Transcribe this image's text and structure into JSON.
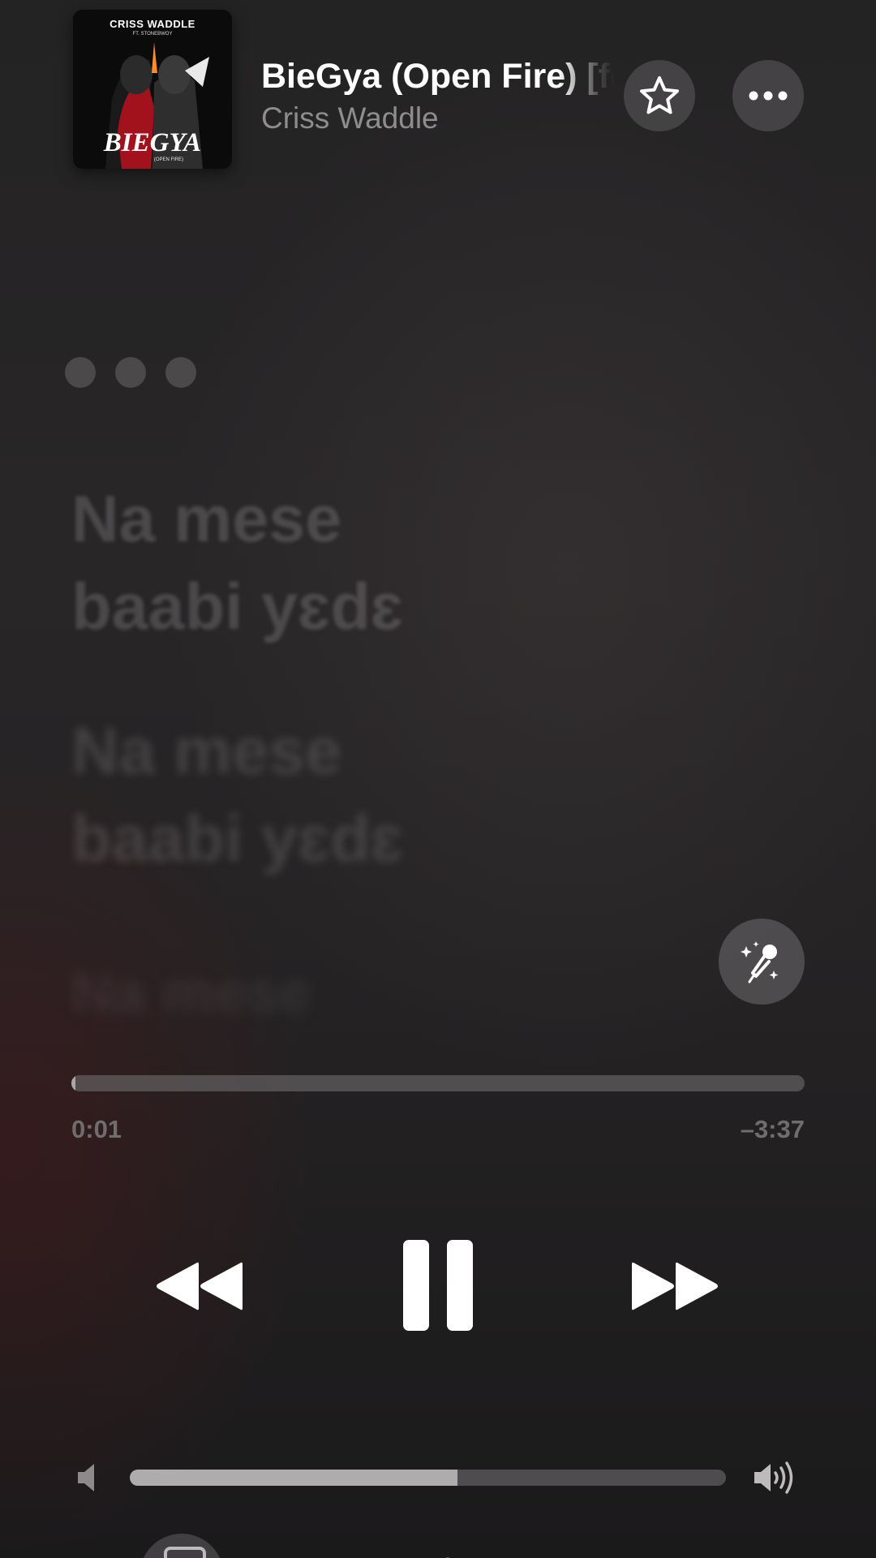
{
  "now_playing": {
    "artwork": {
      "top_text": "CRISS WADDLE",
      "sub_text": "FT. STONEBWOY",
      "main_text": "BIEGYA",
      "small_text": "(OPEN FIRE)"
    },
    "title": "BieGya (Open Fire) [feat. Stonebwoy]",
    "artist": "Criss Waddle"
  },
  "header_actions": {
    "favorite_icon": "star-icon",
    "more_icon": "ellipsis-icon"
  },
  "lyrics": {
    "lines": [
      "Na mese\nbaabi yɛdɛ",
      "Na mese\nbaabi yɛdɛ",
      "Na mese"
    ],
    "singalong_icon": "microphone-sparkle-icon"
  },
  "playback": {
    "elapsed": "0:01",
    "remaining": "–3:37",
    "progress": 0.005
  },
  "transport": {
    "rewind_icon": "backward-icon",
    "pause_icon": "pause-icon",
    "forward_icon": "forward-icon"
  },
  "volume": {
    "level": 0.55,
    "low_icon": "speaker-low-icon",
    "high_icon": "speaker-high-icon"
  },
  "colors": {
    "background": "#242324",
    "accent_text": "#ffffff",
    "secondary_text": "#8e8c8d"
  }
}
